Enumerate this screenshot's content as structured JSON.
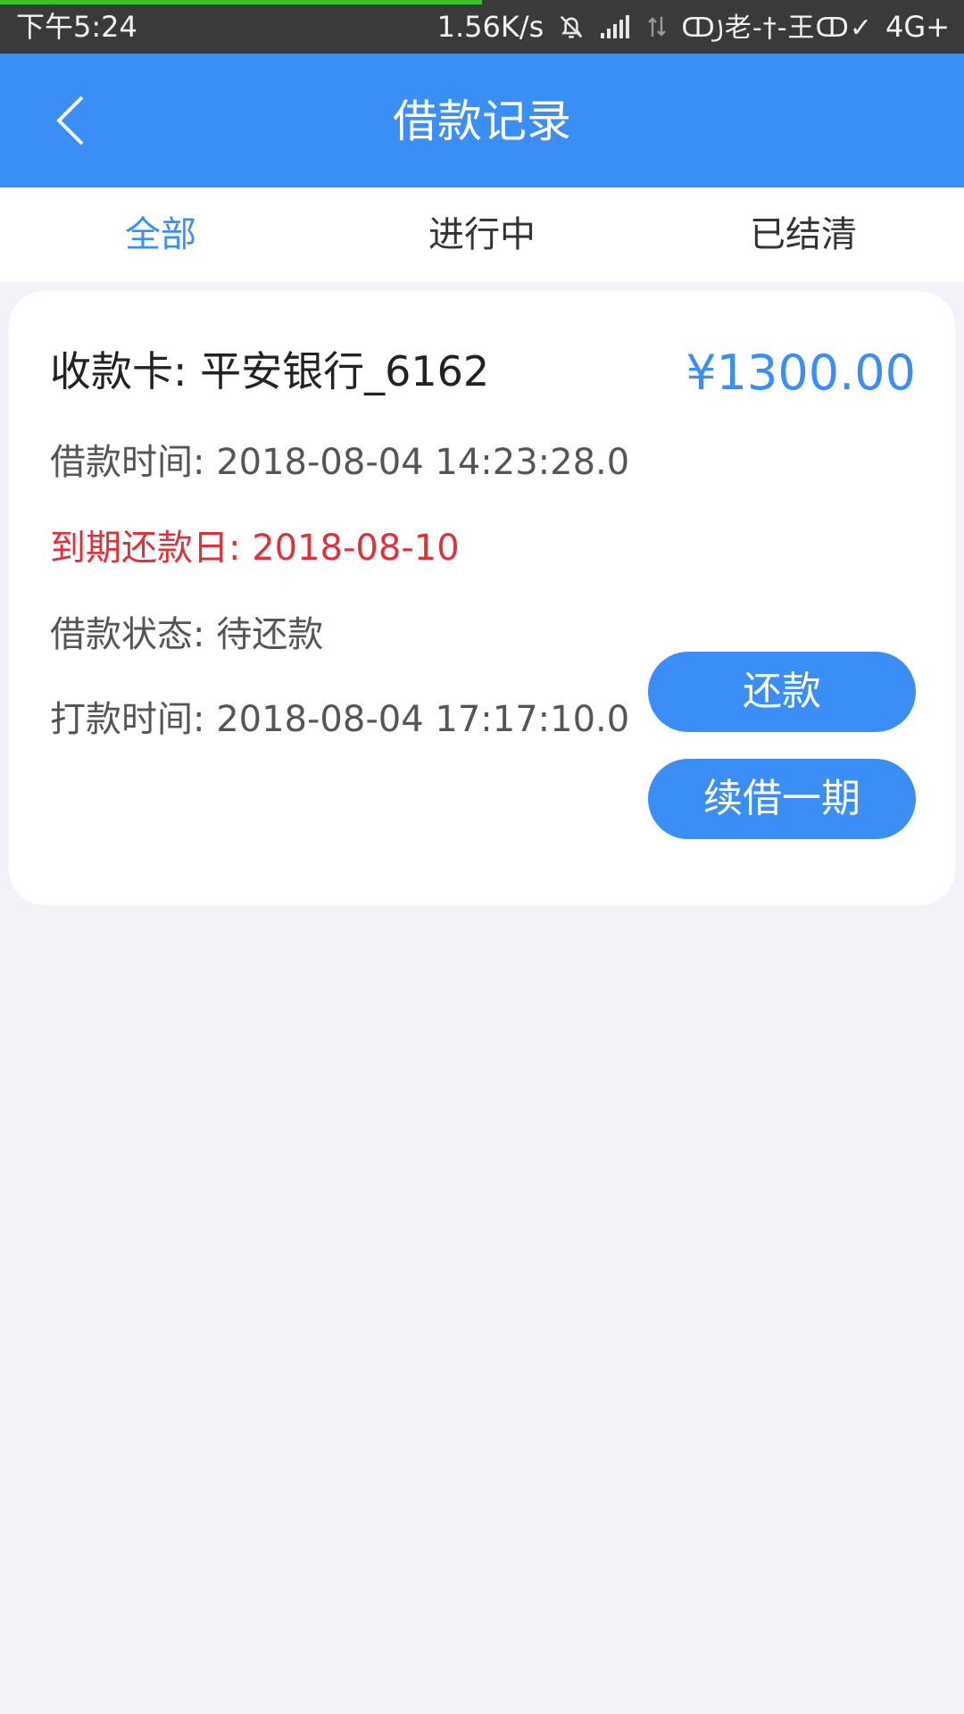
{
  "status_bar": {
    "time": "下午5:24",
    "speed": "1.56K/s",
    "carrier": "ↀ꠸老-†-王ↀ✓",
    "network": "4G+",
    "progress_fraction": 0.5
  },
  "nav": {
    "title": "借款记录",
    "back_icon": "chevron-left-icon"
  },
  "tabs": [
    {
      "label": "全部",
      "active": true
    },
    {
      "label": "进行中",
      "active": false
    },
    {
      "label": "已结清",
      "active": false
    }
  ],
  "loan": {
    "bank": "收款卡: 平安银行_6162",
    "amount": "¥1300.00",
    "loan_time": "借款时间: 2018-08-04 14:23:28.0",
    "due_date": "到期还款日: 2018-08-10",
    "status": "借款状态: 待还款",
    "pay_time": "打款时间: 2018-08-04 17:17:10.0",
    "repay_button": "还款",
    "renew_button": "续借一期"
  },
  "colors": {
    "primary": "#3a8ef6",
    "due": "#e0313a",
    "background": "#f1f3f8"
  }
}
